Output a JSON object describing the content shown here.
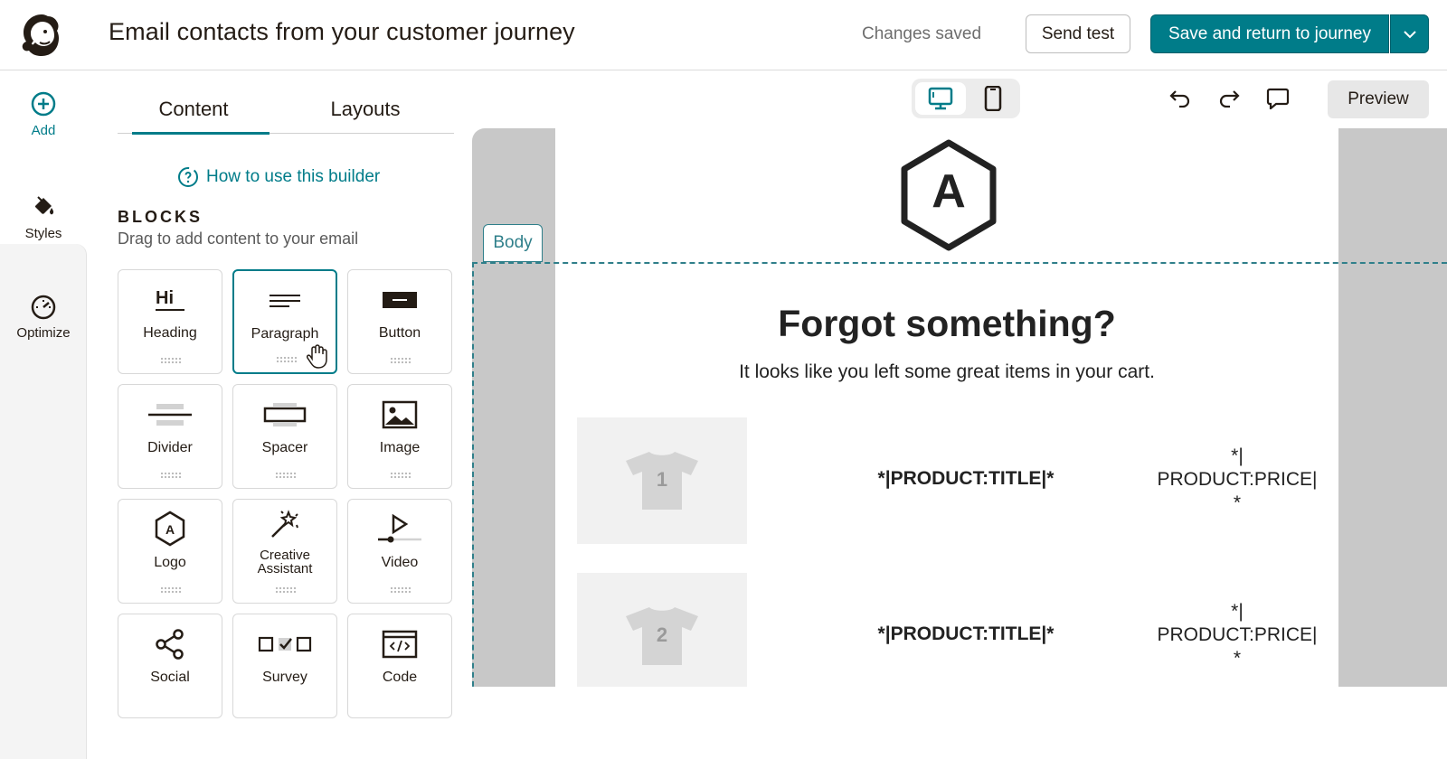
{
  "header": {
    "title": "Email contacts from your customer journey",
    "status": "Changes saved",
    "send_test_label": "Send test",
    "save_label": "Save and return to journey",
    "accent_color": "#007c89"
  },
  "rail": {
    "add_label": "Add",
    "styles_label": "Styles",
    "optimize_label": "Optimize"
  },
  "panel": {
    "tabs": [
      {
        "label": "Content",
        "active": true
      },
      {
        "label": "Layouts",
        "active": false
      }
    ],
    "help_link": "How to use this builder",
    "blocks_heading": "BLOCKS",
    "blocks_sub": "Drag to add content to your email",
    "blocks": [
      {
        "label": "Heading",
        "icon": "heading-icon"
      },
      {
        "label": "Paragraph",
        "icon": "paragraph-icon",
        "active": true
      },
      {
        "label": "Button",
        "icon": "button-icon"
      },
      {
        "label": "Divider",
        "icon": "divider-icon"
      },
      {
        "label": "Spacer",
        "icon": "spacer-icon"
      },
      {
        "label": "Image",
        "icon": "image-icon"
      },
      {
        "label": "Logo",
        "icon": "logo-icon"
      },
      {
        "label": "Creative\nAssistant",
        "icon": "magic-wand-icon"
      },
      {
        "label": "Video",
        "icon": "video-icon"
      },
      {
        "label": "Social",
        "icon": "share-icon"
      },
      {
        "label": "Survey",
        "icon": "survey-icon"
      },
      {
        "label": "Code",
        "icon": "code-icon"
      }
    ]
  },
  "canvas": {
    "preview_label": "Preview",
    "body_tag": "Body",
    "logo_letter": "A",
    "headline": "Forgot something?",
    "subline": "It looks like you left some great items in your cart.",
    "products": [
      {
        "number": "1",
        "title": "*|PRODUCT:TITLE|*",
        "price": "*|\nPRODUCT:PRICE|\n*"
      },
      {
        "number": "2",
        "title": "*|PRODUCT:TITLE|*",
        "price": "*|\nPRODUCT:PRICE|\n*"
      }
    ]
  }
}
